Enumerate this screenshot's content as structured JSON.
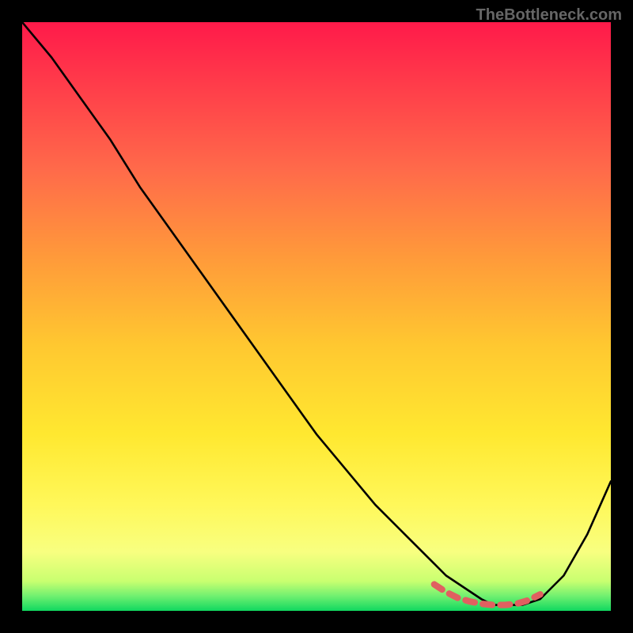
{
  "watermark": "TheBottleneck.com",
  "chart_data": {
    "type": "line",
    "title": "",
    "xlabel": "",
    "ylabel": "",
    "xlim": [
      0,
      100
    ],
    "ylim": [
      0,
      100
    ],
    "series": [
      {
        "name": "bottleneck-curve",
        "x": [
          0,
          5,
          10,
          15,
          20,
          25,
          30,
          35,
          40,
          45,
          50,
          55,
          60,
          65,
          70,
          72,
          75,
          78,
          80,
          82,
          85,
          88,
          92,
          96,
          100
        ],
        "y": [
          100,
          94,
          87,
          80,
          72,
          65,
          58,
          51,
          44,
          37,
          30,
          24,
          18,
          13,
          8,
          6,
          4,
          2,
          1,
          1,
          1,
          2,
          6,
          13,
          22
        ]
      },
      {
        "name": "optimal-zone-marker",
        "x": [
          70,
          72,
          74,
          76,
          78,
          80,
          82,
          84,
          86,
          88
        ],
        "y": [
          4.5,
          3.2,
          2.2,
          1.6,
          1.2,
          1.0,
          1.0,
          1.2,
          1.8,
          2.8
        ]
      }
    ],
    "background_gradient": {
      "stops": [
        {
          "pos": 0.0,
          "color": "#ff1a4a"
        },
        {
          "pos": 0.1,
          "color": "#ff3a4a"
        },
        {
          "pos": 0.25,
          "color": "#ff6a4a"
        },
        {
          "pos": 0.4,
          "color": "#ff9a3a"
        },
        {
          "pos": 0.55,
          "color": "#ffc830"
        },
        {
          "pos": 0.7,
          "color": "#ffe830"
        },
        {
          "pos": 0.82,
          "color": "#fff85a"
        },
        {
          "pos": 0.9,
          "color": "#f8ff80"
        },
        {
          "pos": 0.95,
          "color": "#c8ff70"
        },
        {
          "pos": 0.975,
          "color": "#70f070"
        },
        {
          "pos": 1.0,
          "color": "#10d860"
        }
      ]
    },
    "marker_color": "#e06060",
    "curve_color": "#000000"
  }
}
